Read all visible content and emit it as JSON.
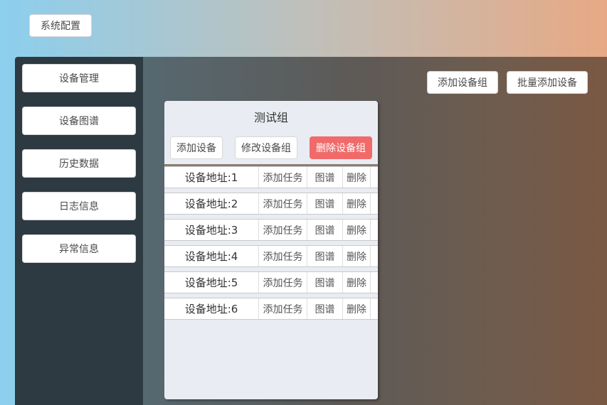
{
  "header": {
    "system_config": "系统配置"
  },
  "sidebar": {
    "items": [
      {
        "label": "设备管理"
      },
      {
        "label": "设备图谱"
      },
      {
        "label": "历史数据"
      },
      {
        "label": "日志信息"
      },
      {
        "label": "异常信息"
      }
    ]
  },
  "toolbar": {
    "add_group": "添加设备组",
    "batch_add": "批量添加设备"
  },
  "group": {
    "title": "测试组",
    "add_device": "添加设备",
    "edit_group": "修改设备组",
    "delete_group": "删除设备组",
    "row_actions": {
      "add_task": "添加任务",
      "graph": "图谱",
      "delete": "删除"
    },
    "devices": [
      {
        "address": "设备地址:1"
      },
      {
        "address": "设备地址:2"
      },
      {
        "address": "设备地址:3"
      },
      {
        "address": "设备地址:4"
      },
      {
        "address": "设备地址:5"
      },
      {
        "address": "设备地址:6"
      }
    ]
  },
  "colors": {
    "sidebar_bg": "#2d3a42",
    "danger": "#f16a6a",
    "card_bg": "#e9ecf2"
  }
}
